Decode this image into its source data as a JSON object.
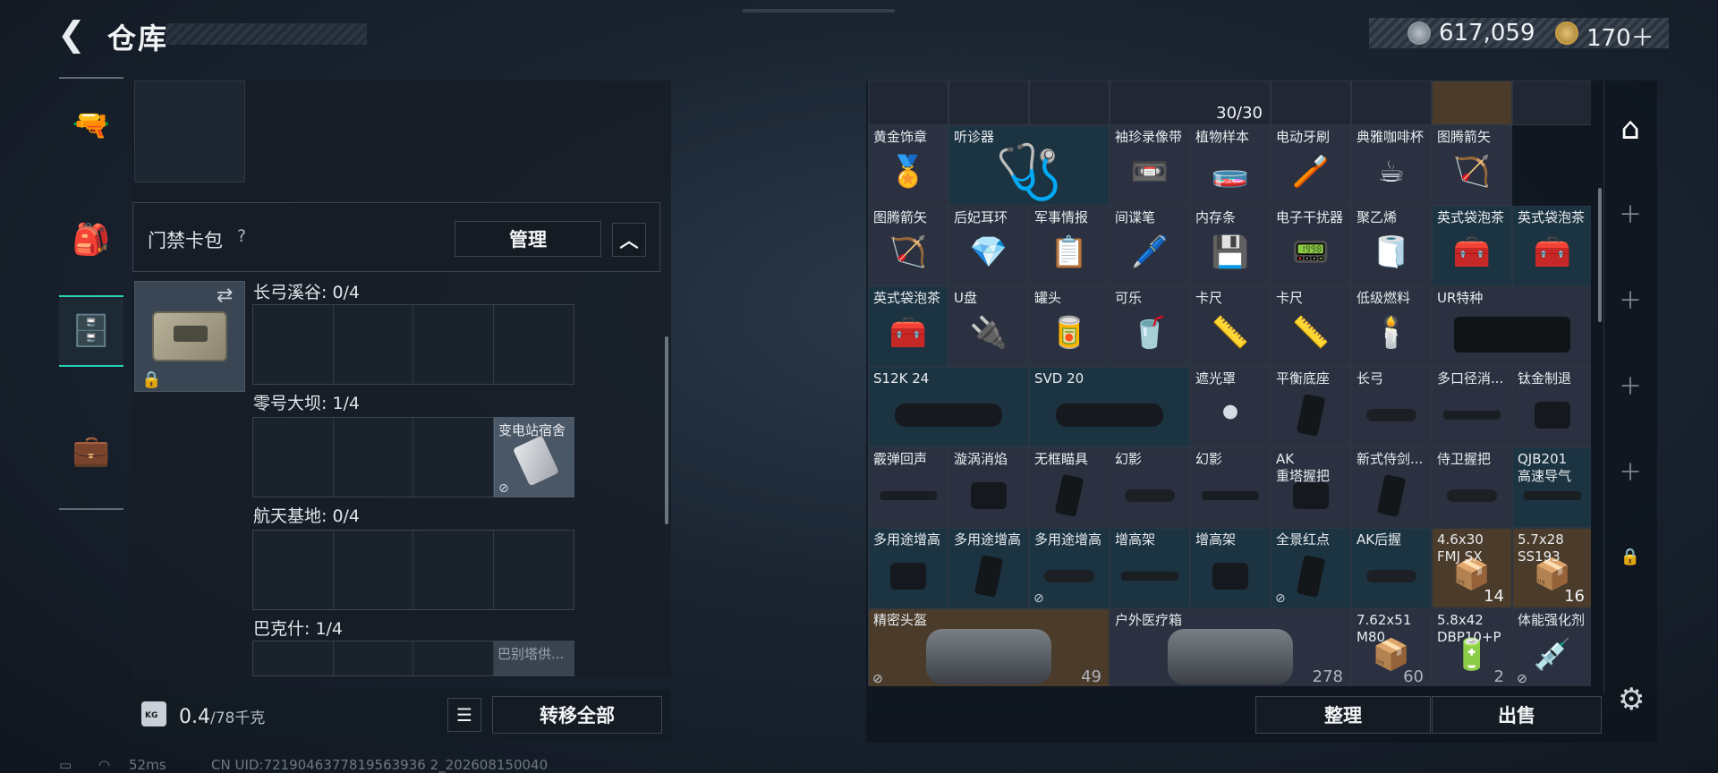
{
  "header": {
    "title": "仓库",
    "back_icon": "chevron-left-icon"
  },
  "currency": {
    "silver": "617,059",
    "gold": "170＋"
  },
  "left_panel": {
    "key_wallet_label": "门禁卡包",
    "help": "?",
    "manage_label": "管理",
    "collapse_icon": "chevron-up-icon",
    "maps": [
      {
        "title": "长弓溪谷: 0/4"
      },
      {
        "title": "零号大坝: 1/4",
        "card": "变电站宿舍"
      },
      {
        "title": "航天基地: 0/4"
      },
      {
        "title": "巴克什: 1/4",
        "card": "巴别塔供..."
      }
    ],
    "weight": "0.4",
    "weight_unit": "/78千克",
    "transfer_all": "转移全部"
  },
  "status": {
    "ping": "52ms",
    "uid": "CN UID:7219046377819563936 2_202608150040"
  },
  "stash": {
    "top_count": "30/30",
    "rows": [
      [
        {
          "n": "黄金饰章",
          "i": "🏅",
          "c": "def"
        },
        {
          "n": "听诊器",
          "i": "🩺",
          "c": "blue"
        },
        {
          "n": "袖珍录像带",
          "i": "📼",
          "c": "def"
        },
        {
          "n": "植物样本",
          "i": "🧫",
          "c": "def"
        },
        {
          "n": "电动牙刷",
          "i": "🪥",
          "c": "def"
        },
        {
          "n": "典雅咖啡杯",
          "i": "☕",
          "c": "def"
        },
        {
          "n": "图腾箭矢",
          "i": "🏹",
          "c": "def"
        }
      ],
      [
        {
          "n": "图腾箭矢",
          "i": "🏹",
          "c": "def"
        },
        {
          "n": "后妃耳环",
          "i": "💎",
          "c": "def"
        },
        {
          "n": "军事情报",
          "i": "📋",
          "c": "def"
        },
        {
          "n": "间谍笔",
          "i": "🖊️",
          "c": "def"
        },
        {
          "n": "内存条",
          "i": "💾",
          "c": "def"
        },
        {
          "n": "电子干扰器",
          "i": "📟",
          "c": "def"
        },
        {
          "n": "聚乙烯",
          "i": "🧻",
          "c": "def"
        },
        {
          "n": "英式袋泡茶",
          "i": "🧰",
          "c": "blue"
        },
        {
          "n": "英式袋泡茶",
          "i": "🧰",
          "c": "blue"
        }
      ],
      [
        {
          "n": "英式袋泡茶",
          "i": "🧰",
          "c": "blue"
        },
        {
          "n": "U盘",
          "i": "🔌",
          "c": "def"
        },
        {
          "n": "罐头",
          "i": "🥫",
          "c": "def"
        },
        {
          "n": "可乐",
          "i": "🥤",
          "c": "def"
        },
        {
          "n": "卡尺",
          "i": "📏",
          "c": "def"
        },
        {
          "n": "卡尺",
          "i": "📏",
          "c": "def"
        },
        {
          "n": "低级燃料",
          "i": "🕯️",
          "c": "def"
        }
      ],
      [
        {
          "n": "S12K 24",
          "c": "blue"
        },
        {
          "n": "SVD 20",
          "c": "blue"
        },
        {
          "n": "遮光罩",
          "i": "⚫",
          "c": "def"
        },
        {
          "n": "平衡底座",
          "c": "def"
        },
        {
          "n": "长弓",
          "c": "def"
        },
        {
          "n": "多口径消...",
          "c": "def"
        },
        {
          "n": "钛金制退",
          "c": "def"
        }
      ],
      [
        {
          "n": "霰弹回声",
          "c": "def"
        },
        {
          "n": "漩涡消焰",
          "c": "def"
        },
        {
          "n": "无框瞄具",
          "c": "def"
        },
        {
          "n": "幻影",
          "c": "def"
        },
        {
          "n": "幻影",
          "c": "def"
        },
        {
          "n": "AK\n重塔握把",
          "c": "def"
        },
        {
          "n": "新式侍剑...",
          "c": "def"
        },
        {
          "n": "侍卫握把",
          "c": "def"
        },
        {
          "n": "QJB201\n高速导气",
          "c": "blue"
        }
      ],
      [
        {
          "n": "多用途增高",
          "c": "blue"
        },
        {
          "n": "多用途增高",
          "c": "blue"
        },
        {
          "n": "多用途增高",
          "c": "blue"
        },
        {
          "n": "增高架",
          "c": "blue"
        },
        {
          "n": "增高架",
          "c": "blue"
        },
        {
          "n": "全景红点",
          "c": "blue"
        },
        {
          "n": "AK后握",
          "c": "blue"
        },
        {
          "n": "4.6x30\nFMJ SX",
          "i": "📦",
          "c": "gold",
          "q": "14"
        },
        {
          "n": "5.7x28\nSS193",
          "i": "📦",
          "c": "gold",
          "q": "16"
        }
      ],
      [
        {
          "n": "精密头盔",
          "c": "gold",
          "q": "49"
        },
        {
          "n": "户外医疗箱",
          "c": "def",
          "q": "278"
        },
        {
          "n": "7.62x51\nM80",
          "i": "📦",
          "c": "def",
          "q": "60"
        },
        {
          "n": "5.8x42\nDBP10+P",
          "i": "🔋",
          "c": "def",
          "q": "2"
        },
        {
          "n": "体能强化剂",
          "i": "💉",
          "c": "def"
        }
      ]
    ],
    "special": {
      "ur_stock": "UR特种"
    },
    "arrange": "整理",
    "sell": "出售"
  },
  "nav_icons": [
    "pistol-icon",
    "backpack-icon",
    "locker-icon",
    "briefcase-icon"
  ],
  "side_icons": [
    "stash-tab-icon",
    "plus-icon",
    "plus-icon",
    "plus-icon",
    "plus-icon",
    "plus-icon",
    "lock-icon"
  ],
  "colors": {
    "accent": "#29d2b6"
  }
}
